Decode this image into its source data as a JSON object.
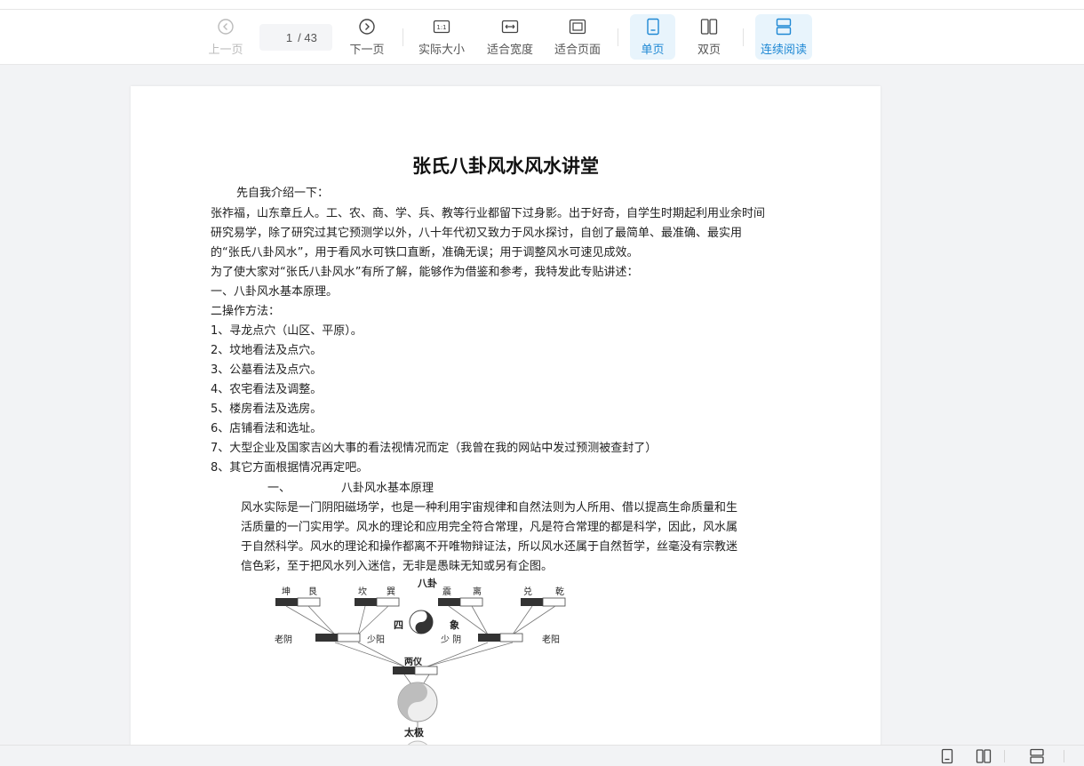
{
  "toolbar": {
    "prev_label": "上一页",
    "page_current": "1",
    "page_total": "/ 43",
    "next_label": "下一页",
    "actual_size_label": "实际大小",
    "fit_width_label": "适合宽度",
    "fit_page_label": "适合页面",
    "single_page_label": "单页",
    "double_page_label": "双页",
    "continuous_label": "连续阅读",
    "actual_size_glyph": "1:1",
    "accent_color": "#1e88d4"
  },
  "document": {
    "title": "张氏八卦风水风水讲堂",
    "lines": [
      "先自我介绍一下：",
      "张祚福，山东章丘人。工、农、商、学、兵、教等行业都留下过身影。出于好奇，自学生时期起利用业余时间",
      "研究易学，除了研究过其它预测学以外，八十年代初又致力于风水探讨，自创了最简单、最准确、最实用",
      "的“张氏八卦风水”，用于看风水可铁口直断，准确无误；用于调整风水可速见成效。",
      "为了使大家对“张氏八卦风水”有所了解，能够作为借鉴和参考，我特发此专贴讲述：",
      "一、八卦风水基本原理。",
      "二操作方法：",
      "1、寻龙点穴（山区、平原）。",
      "2、坟地看法及点穴。",
      "3、公墓看法及点穴。",
      "4、农宅看法及调整。",
      "5、楼房看法及选房。",
      "6、店铺看法和选址。",
      "7、大型企业及国家吉凶大事的看法视情况而定（我曾在我的网站中发过预测被查封了）",
      "8、其它方面根据情况再定吧。"
    ],
    "section_num": "一、",
    "section_title": "八卦风水基本原理",
    "para": [
      "风水实际是一门阴阳磁场学，也是一种利用宇宙规律和自然法则为人所用、借以提高生命质量和生",
      "活质量的一门实用学。风水的理论和应用完全符合常理，凡是符合常理的都是科学，因此，风水属",
      "于自然科学。风水的理论和操作都离不开唯物辩证法，所以风水还属于自然哲学，丝毫没有宗教迷",
      "信色彩，至于把风水列入迷信，无非是愚昧无知或另有企图。"
    ]
  },
  "diagram": {
    "bagua": "八卦",
    "trigrams": [
      "坤",
      "艮",
      "坎",
      "巽",
      "震",
      "离",
      "兑",
      "乾"
    ],
    "sixiang_left": "四",
    "sixiang_right": "象",
    "lao_yin": "老阴",
    "shao_yang": "少阳",
    "shao_yin": "少 阴",
    "lao_yang": "老阳",
    "liangyi": "两仪",
    "taiji": "太极"
  }
}
